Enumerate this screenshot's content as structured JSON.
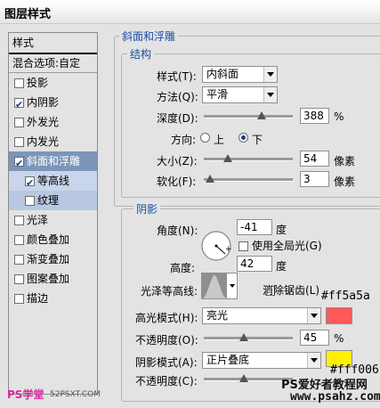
{
  "window": {
    "title": "图层样式"
  },
  "sidebar": {
    "header": "样式",
    "blend_options": "混合选项:自定",
    "items": [
      {
        "label": "投影",
        "checked": false
      },
      {
        "label": "内阴影",
        "checked": true
      },
      {
        "label": "外发光",
        "checked": false
      },
      {
        "label": "内发光",
        "checked": false
      },
      {
        "label": "斜面和浮雕",
        "checked": true
      },
      {
        "label": "等高线",
        "checked": true
      },
      {
        "label": "纹理",
        "checked": false
      },
      {
        "label": "光泽",
        "checked": false
      },
      {
        "label": "颜色叠加",
        "checked": false
      },
      {
        "label": "渐变叠加",
        "checked": false
      },
      {
        "label": "图案叠加",
        "checked": false
      },
      {
        "label": "描边",
        "checked": false
      }
    ]
  },
  "bevel": {
    "section_title": "斜面和浮雕",
    "structure": {
      "title": "结构",
      "style_label": "样式(T):",
      "style_value": "内斜面",
      "technique_label": "方法(Q):",
      "technique_value": "平滑",
      "depth_label": "深度(D):",
      "depth_value": "388",
      "depth_unit": "%",
      "direction_label": "方向:",
      "direction_up": "上",
      "direction_down": "下",
      "direction_selected": "down",
      "size_label": "大小(Z):",
      "size_value": "54",
      "size_unit": "像素",
      "soften_label": "软化(F):",
      "soften_value": "3",
      "soften_unit": "像素"
    },
    "shading": {
      "title": "阴影",
      "angle_label": "角度(N):",
      "angle_value": "-41",
      "angle_unit": "度",
      "global_light_label": "使用全局光(G)",
      "altitude_label": "高度:",
      "altitude_value": "42",
      "altitude_unit": "度",
      "gloss_label": "光泽等高线:",
      "antialias_label": "消除锯齿(L)",
      "highlight_label": "高光模式(H):",
      "highlight_mode": "亮光",
      "highlight_color": "#ff5a5a",
      "highlight_hex": "#ff5a5a",
      "highlight_opacity_label": "不透明度(O):",
      "highlight_opacity": "45",
      "opacity_unit": "%",
      "shadow_label": "阴影模式(A):",
      "shadow_mode": "正片叠底",
      "shadow_color": "#fff006",
      "shadow_hex": "#fff006",
      "shadow_opacity_label": "不透明度(C):"
    }
  },
  "watermarks": {
    "left": "PS学堂",
    "left_url": "52PSXT.COM",
    "right_top": "PS爱好者教程网",
    "right_bottom": "www.psahz.com"
  }
}
